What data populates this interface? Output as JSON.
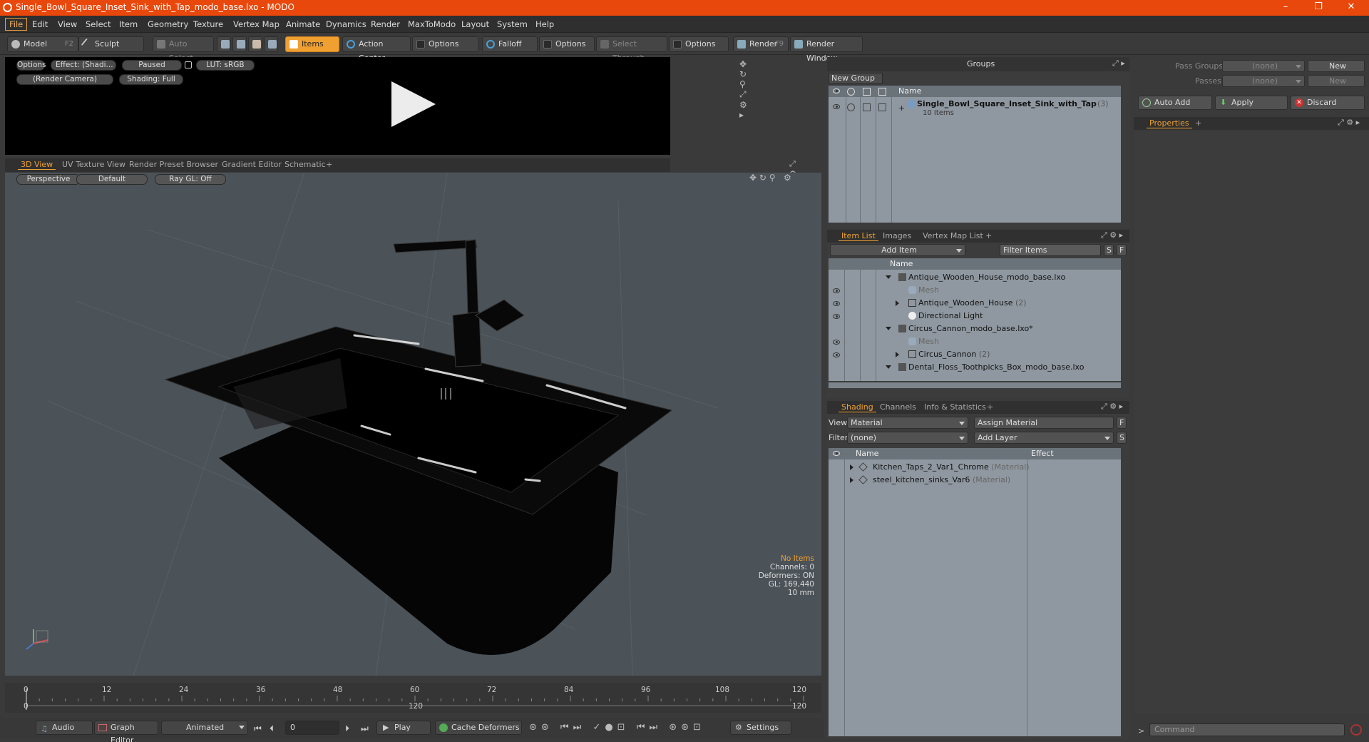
{
  "window": {
    "title": "Single_Bowl_Square_Inset_Sink_with_Tap_modo_base.lxo - MODO",
    "controls": [
      "–",
      "❐",
      "✕"
    ]
  },
  "menu": [
    "File",
    "Edit",
    "View",
    "Select",
    "Item",
    "Geometry",
    "Texture",
    "Vertex Map",
    "Animate",
    "Dynamics",
    "Render",
    "MaxToModo",
    "Layout",
    "System",
    "Help"
  ],
  "toolbar": {
    "model": "Model",
    "model_key": "F2",
    "sculpt": "Sculpt",
    "auto_select": "Auto Select",
    "items": "Items",
    "action_center": "Action Center",
    "options1": "Options",
    "falloff": "Falloff",
    "options2": "Options",
    "select_through": "Select Through",
    "options3": "Options",
    "render": "Render",
    "render_key": "F9",
    "render_window": "Render Window"
  },
  "preview": {
    "options": "Options",
    "effect": "Effect: (Shadi...",
    "paused": "Paused",
    "lut": "LUT: sRGB",
    "camera": "(Render Camera)",
    "shading": "Shading: Full"
  },
  "view_tabs": [
    "3D View",
    "UV Texture View",
    "Render Preset Browser",
    "Gradient Editor",
    "Schematic",
    "+"
  ],
  "viewport": {
    "perspective": "Perspective",
    "default": "Default",
    "raygl": "Ray GL: Off",
    "hud": {
      "no_items": "No Items",
      "channels": "Channels: 0",
      "deformers": "Deformers: ON",
      "gl": "GL: 169,440",
      "unit": "10 mm"
    }
  },
  "timeline": {
    "ticks": [
      "0",
      "12",
      "24",
      "36",
      "48",
      "60",
      "72",
      "84",
      "96",
      "108",
      "120"
    ],
    "range_start": "0",
    "range_mid": "120",
    "range_end": "120"
  },
  "bottombar": {
    "audio": "Audio",
    "graph_editor": "Graph Editor",
    "animated": "Animated",
    "frame": "0",
    "play": "Play",
    "cache_deformers": "Cache Deformers",
    "settings": "Settings"
  },
  "groups": {
    "title": "Groups",
    "new_group": "New Group",
    "col_name": "Name",
    "item_name": "Single_Bowl_Square_Inset_Sink_with_Tap",
    "item_count": "(3)",
    "item_sub": "10 Items"
  },
  "item_list": {
    "tabs": [
      "Item List",
      "Images",
      "Vertex Map List",
      "+"
    ],
    "add_item": "Add Item",
    "filter_items": "Filter Items",
    "btn_s": "S",
    "btn_f": "F",
    "col_name": "Name",
    "rows": [
      {
        "label": "Antique_Wooden_House_modo_base.lxo",
        "count": ""
      },
      {
        "label": "Mesh",
        "count": ""
      },
      {
        "label": "Antique_Wooden_House",
        "count": "(2)"
      },
      {
        "label": "Directional Light",
        "count": ""
      },
      {
        "label": "Circus_Cannon_modo_base.lxo*",
        "count": ""
      },
      {
        "label": "Mesh",
        "count": ""
      },
      {
        "label": "Circus_Cannon",
        "count": "(2)"
      },
      {
        "label": "Dental_Floss_Toothpicks_Box_modo_base.lxo",
        "count": ""
      }
    ]
  },
  "shading": {
    "tabs": [
      "Shading",
      "Channels",
      "Info & Statistics",
      "+"
    ],
    "view_label": "View",
    "view_value": "Material",
    "assign_material": "Assign Material",
    "filter_label": "Filter",
    "filter_value": "(none)",
    "add_layer": "Add Layer",
    "btn_f": "F",
    "btn_s": "S",
    "col_name": "Name",
    "col_effect": "Effect",
    "rows": [
      {
        "label": "Kitchen_Taps_2_Var1_Chrome",
        "type": "(Material)"
      },
      {
        "label": "steel_kitchen_sinks_Var6",
        "type": "(Material)"
      }
    ]
  },
  "right_panel": {
    "pass_groups": "Pass Groups",
    "passes": "Passes",
    "none1": "(none)",
    "none2": "(none)",
    "new1": "New",
    "new2": "New",
    "auto_add": "Auto Add",
    "apply": "Apply",
    "discard": "Discard",
    "properties_tab": "Properties",
    "plus": "+",
    "command_placeholder": "Command"
  },
  "colors": {
    "accent": "#f0a030",
    "titlebar": "#e8480c",
    "viewport_bg": "#4b5258",
    "list_bg": "#8f98a0"
  }
}
